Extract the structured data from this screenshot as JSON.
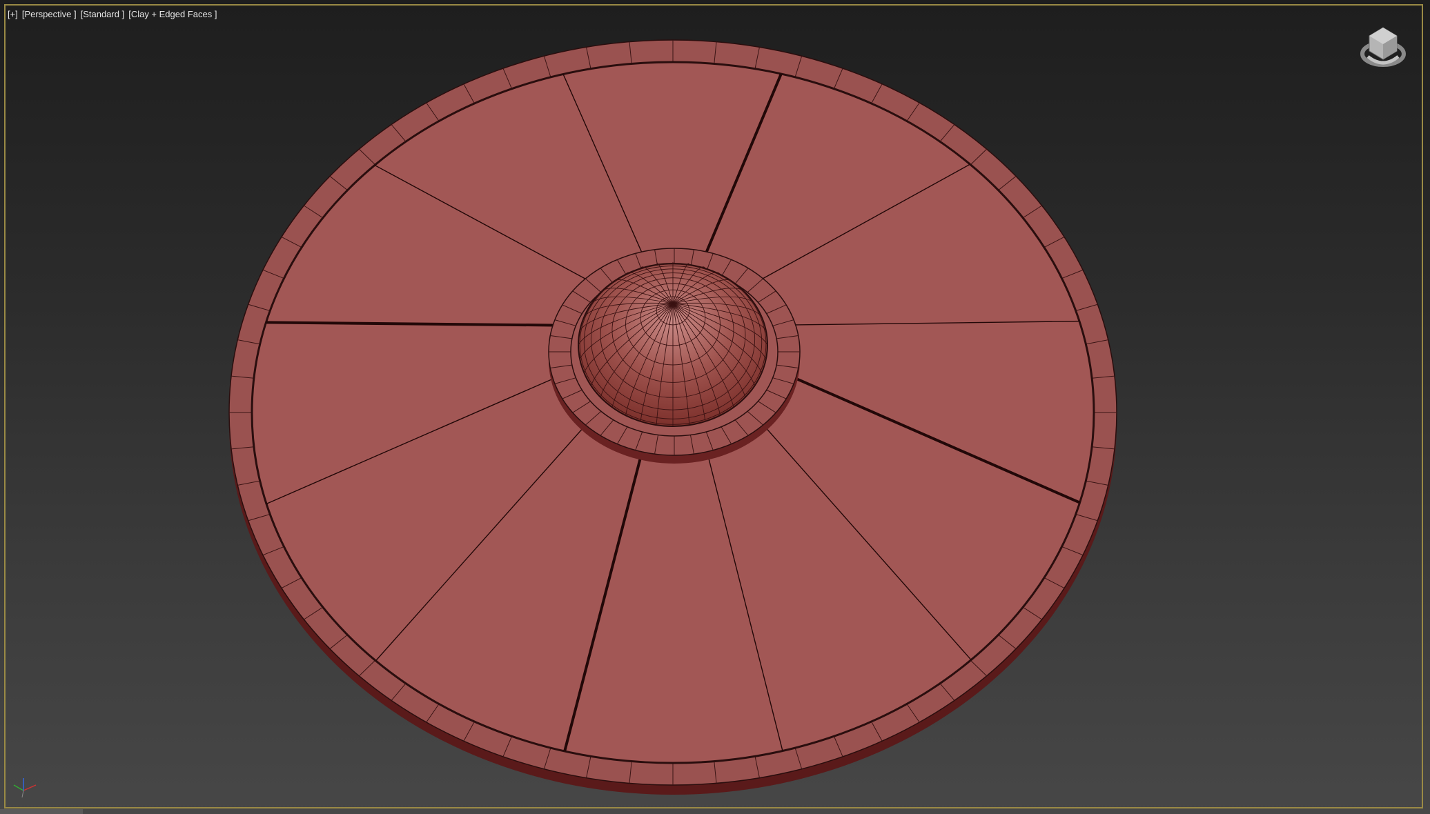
{
  "viewport": {
    "labels": {
      "plus": "[+]",
      "view": "[Perspective ]",
      "shading_mode": "[Standard ]",
      "display_mode": "[Clay + Edged Faces ]"
    },
    "border_color": "#9a8a45"
  },
  "scene": {
    "object": "circular-platform-with-dome",
    "clay_color": "#a05654",
    "wedge_sections": 12,
    "rim_segments": 64,
    "dome_segments": 36
  },
  "icons": {
    "viewcube": "viewcube-icon",
    "axis": "axis-tripod-icon"
  }
}
